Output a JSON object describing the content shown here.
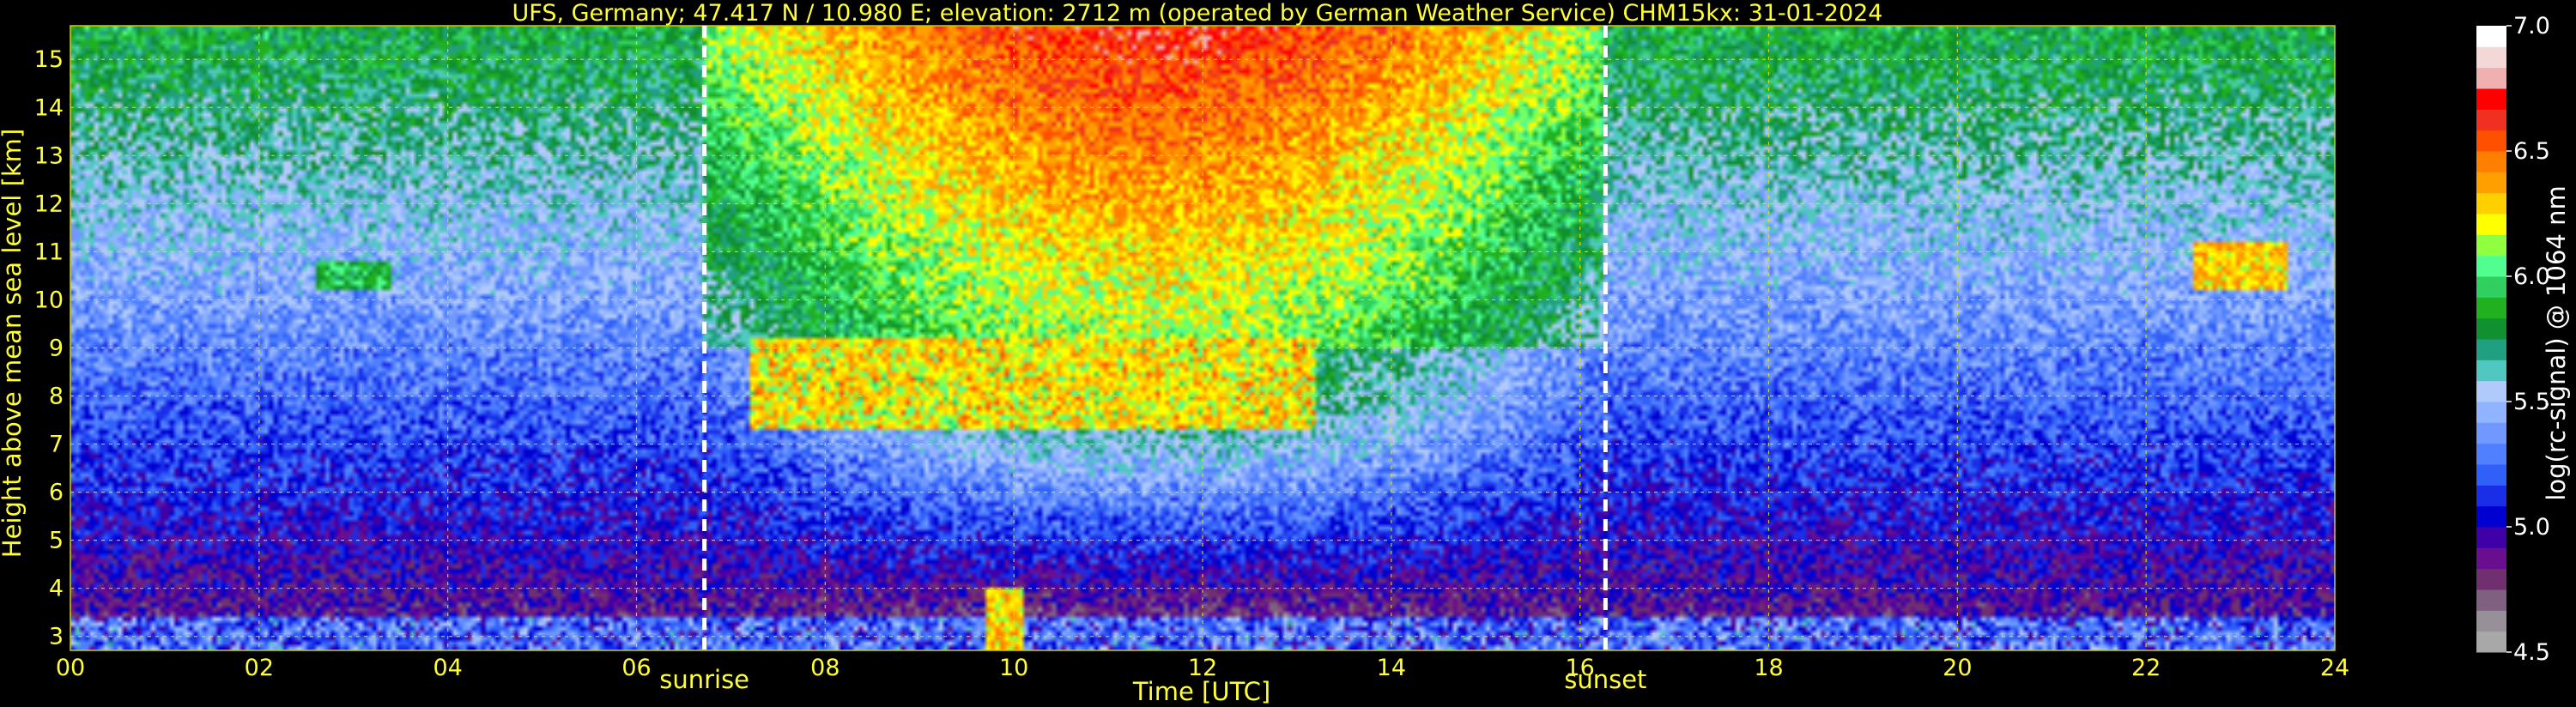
{
  "chart_data": {
    "type": "heatmap",
    "title": "UFS, Germany; 47.417 N / 10.980 E; elevation: 2712 m  (operated by German Weather Service)    CHM15kx: 31-01-2024",
    "xlabel": "Time [UTC]",
    "ylabel": "Height above mean sea level [km]",
    "xlim": [
      0,
      24
    ],
    "ylim": [
      2.71,
      15.7
    ],
    "x_ticks": [
      "00",
      "02",
      "04",
      "06",
      "08",
      "10",
      "12",
      "14",
      "16",
      "18",
      "20",
      "22",
      "24"
    ],
    "y_ticks": [
      "3",
      "4",
      "5",
      "6",
      "7",
      "8",
      "9",
      "10",
      "11",
      "12",
      "13",
      "14",
      "15"
    ],
    "grid": true,
    "events": [
      {
        "label": "sunrise",
        "time": 6.72
      },
      {
        "label": "sunset",
        "time": 16.27
      }
    ],
    "colorbar": {
      "label": "log(rc-signal) @ 1064 nm",
      "min": 4.5,
      "max": 7.0,
      "ticks": [
        "4.5",
        "5.0",
        "5.5",
        "6.0",
        "6.5",
        "7.0"
      ],
      "colors": [
        "#a8a8a8",
        "#989098",
        "#806080",
        "#703070",
        "#6a0e90",
        "#4000a8",
        "#0000d0",
        "#1a2ee8",
        "#3060f8",
        "#5080ff",
        "#7098ff",
        "#90b4ff",
        "#b0cafc",
        "#50c8c0",
        "#20a080",
        "#109030",
        "#20b020",
        "#30d060",
        "#50ff90",
        "#90ff40",
        "#ffff00",
        "#ffd000",
        "#ffa000",
        "#ff8000",
        "#ff5000",
        "#f03020",
        "#ff0000",
        "#f0b0b0",
        "#f4d8d8",
        "#ffffff"
      ]
    }
  }
}
